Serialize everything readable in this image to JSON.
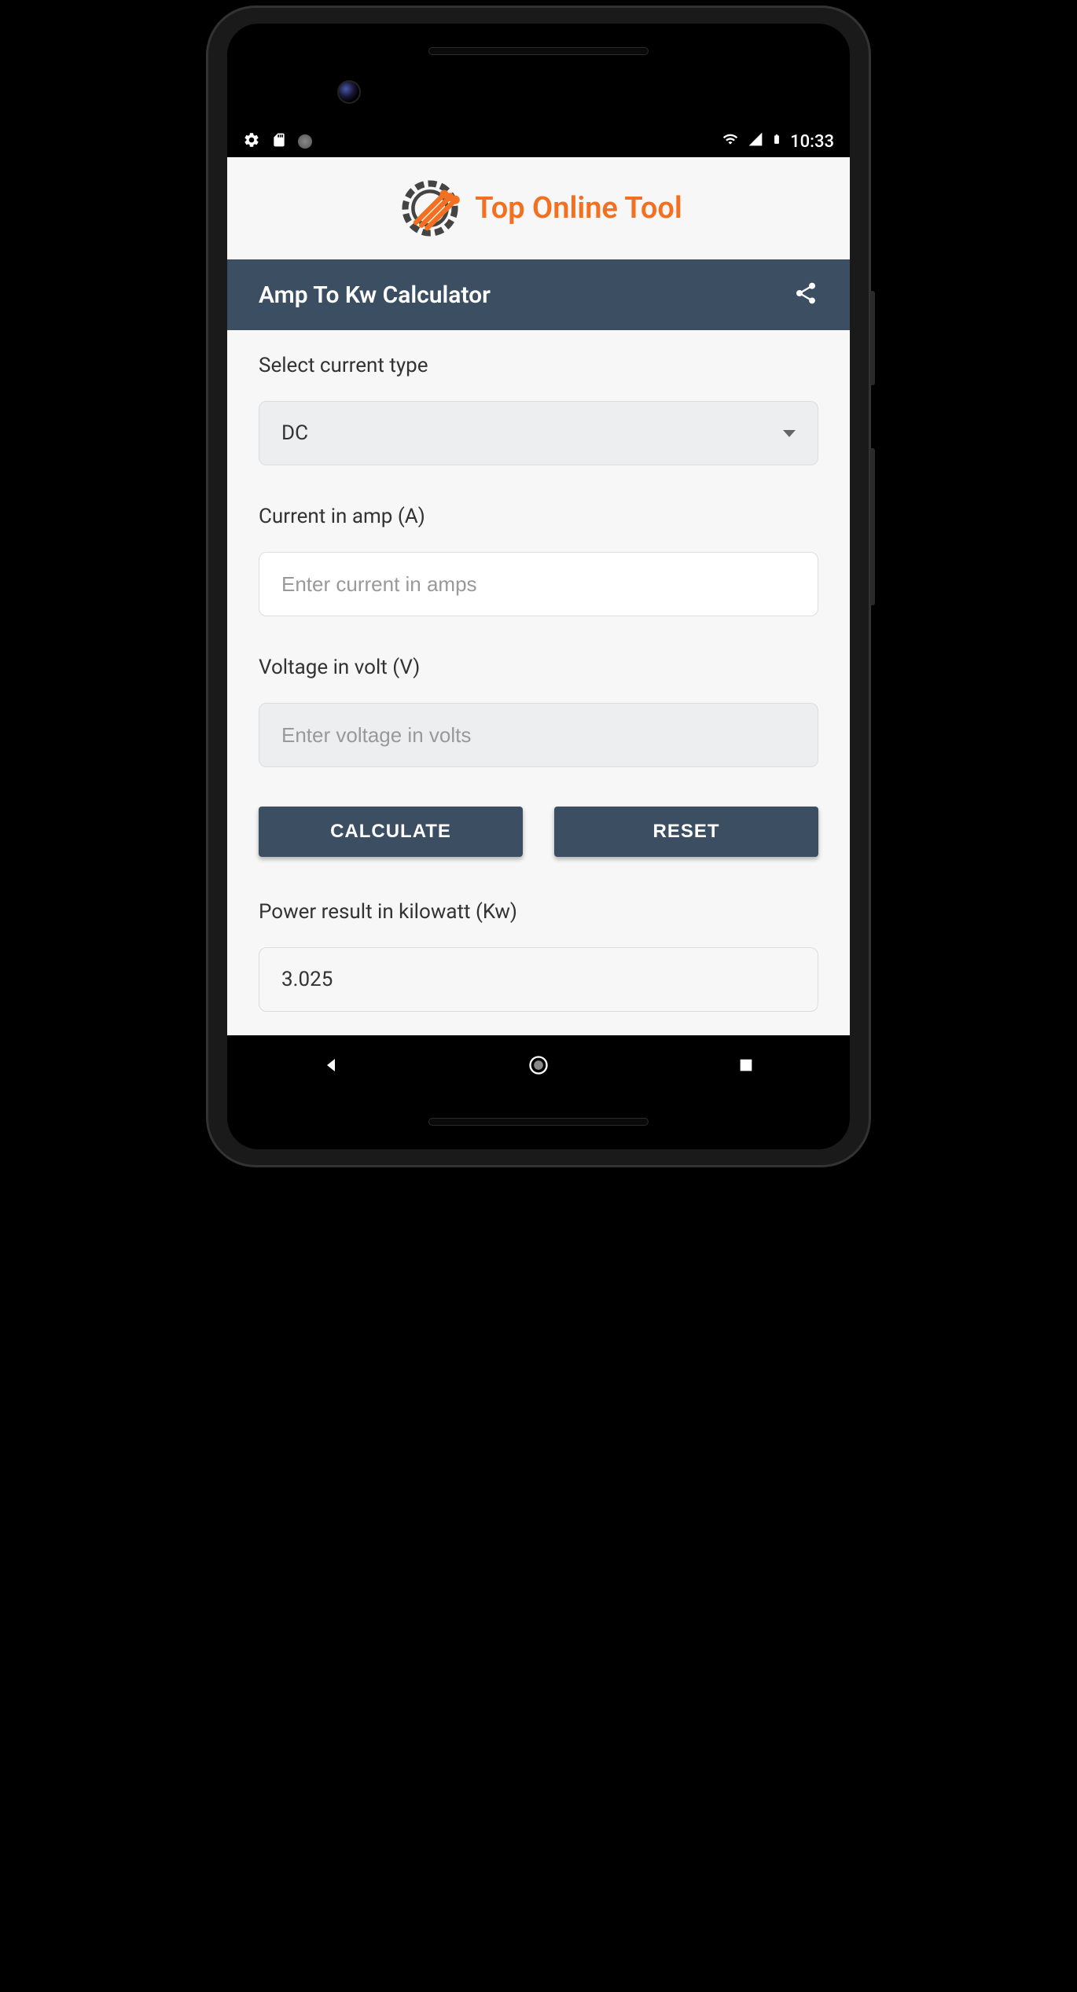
{
  "status": {
    "time": "10:33"
  },
  "logo": {
    "text": "Top Online Tool"
  },
  "titlebar": {
    "title": "Amp To Kw Calculator"
  },
  "form": {
    "current_type": {
      "label": "Select current type",
      "value": "DC"
    },
    "current": {
      "label": "Current in amp (A)",
      "placeholder": "Enter current in amps",
      "value": ""
    },
    "voltage": {
      "label": "Voltage in volt (V)",
      "placeholder": "Enter voltage in volts",
      "value": ""
    },
    "buttons": {
      "calculate": "CALCULATE",
      "reset": "RESET"
    },
    "result": {
      "label": "Power result in kilowatt (Kw)",
      "value": "3.025"
    }
  },
  "colors": {
    "accent": "#f37021",
    "header": "#3c4f62"
  }
}
